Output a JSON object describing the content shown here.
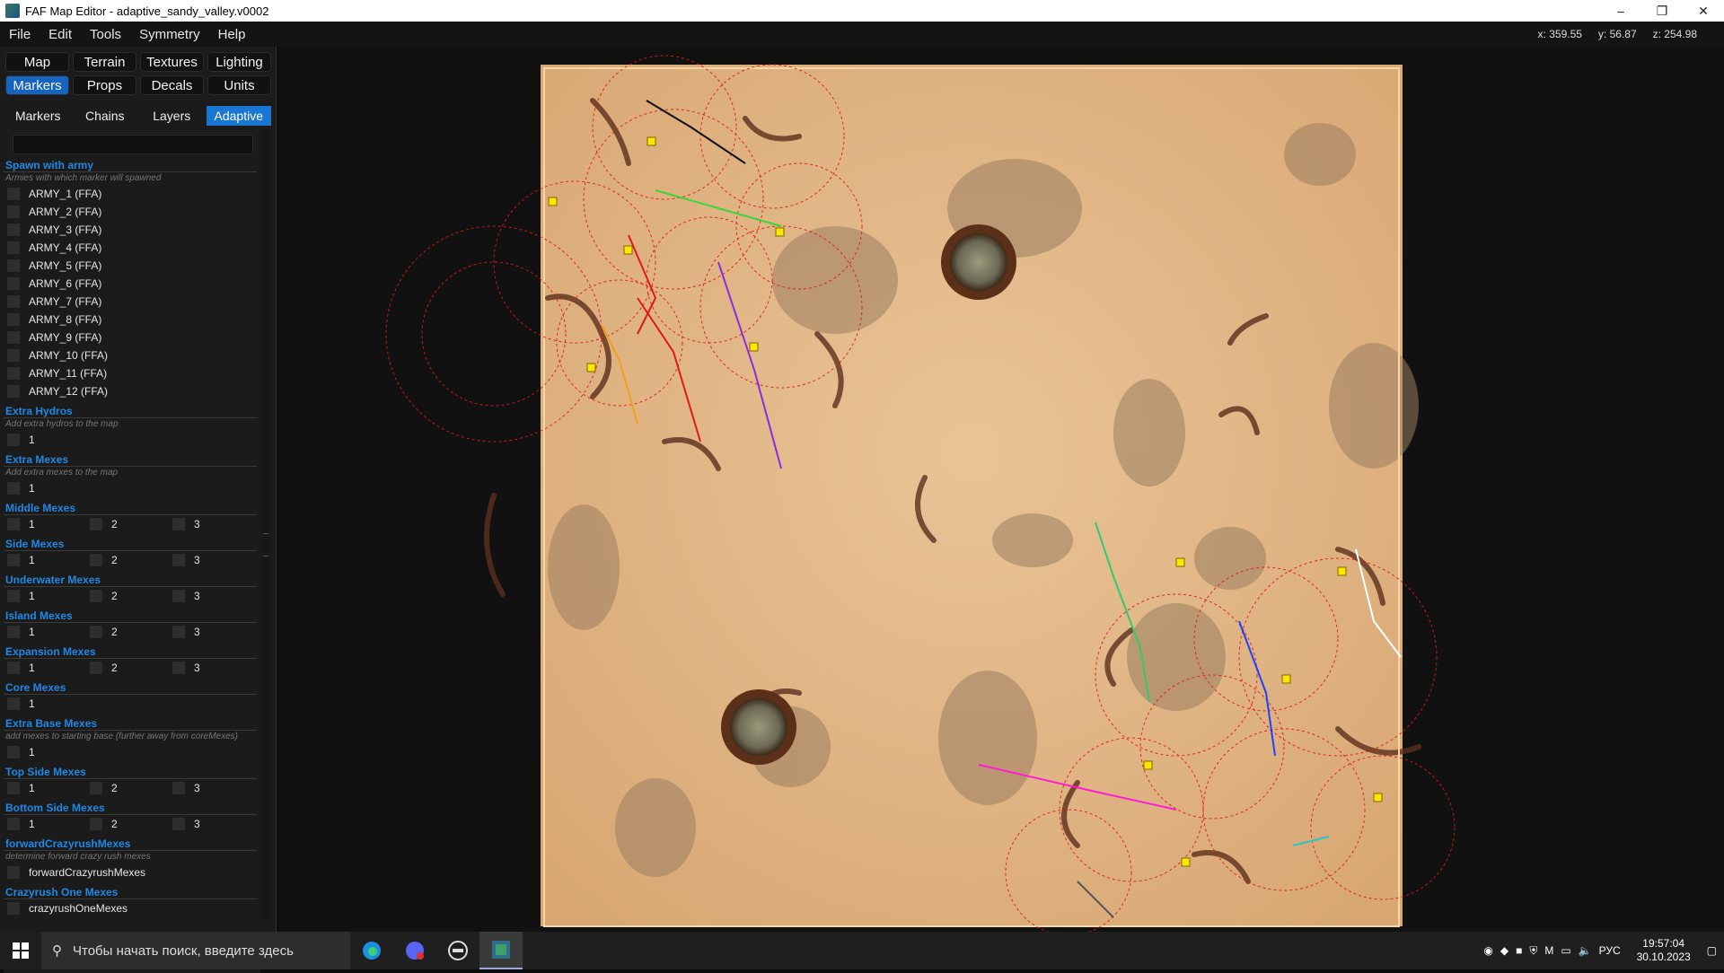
{
  "window": {
    "title": "FAF Map Editor - adaptive_sandy_valley.v0002",
    "minimize": "–",
    "maximize": "❐",
    "close": "✕"
  },
  "menu": [
    "File",
    "Edit",
    "Tools",
    "Symmetry",
    "Help"
  ],
  "coords": {
    "x": "x: 359.55",
    "y": "y: 56.87",
    "z": "z: 254.98"
  },
  "main_tabs": [
    {
      "label": "Map",
      "active": false
    },
    {
      "label": "Terrain",
      "active": false
    },
    {
      "label": "Textures",
      "active": false
    },
    {
      "label": "Lighting",
      "active": false
    },
    {
      "label": "Markers",
      "active": true
    },
    {
      "label": "Props",
      "active": false
    },
    {
      "label": "Decals",
      "active": false
    },
    {
      "label": "Units",
      "active": false
    }
  ],
  "sub_tabs": [
    {
      "label": "Markers",
      "active": false
    },
    {
      "label": "Chains",
      "active": false
    },
    {
      "label": "Layers",
      "active": false
    },
    {
      "label": "Adaptive",
      "active": true
    }
  ],
  "spawn_section": {
    "title": "Spawn with army",
    "desc": "Armies with which marker will spawned",
    "armies": [
      "ARMY_1 (FFA)",
      "ARMY_2 (FFA)",
      "ARMY_3 (FFA)",
      "ARMY_4 (FFA)",
      "ARMY_5 (FFA)",
      "ARMY_6 (FFA)",
      "ARMY_7 (FFA)",
      "ARMY_8 (FFA)",
      "ARMY_9 (FFA)",
      "ARMY_10 (FFA)",
      "ARMY_11 (FFA)",
      "ARMY_12 (FFA)"
    ]
  },
  "sections": [
    {
      "title": "Extra Hydros",
      "desc": "Add extra hydros to the map",
      "options": [
        "1"
      ]
    },
    {
      "title": "Extra Mexes",
      "desc": "Add extra mexes to the map",
      "options": [
        "1"
      ]
    },
    {
      "title": "Middle Mexes",
      "desc": "",
      "options": [
        "1",
        "2",
        "3"
      ]
    },
    {
      "title": "Side Mexes",
      "desc": "",
      "options": [
        "1",
        "2",
        "3"
      ]
    },
    {
      "title": "Underwater Mexes",
      "desc": "",
      "options": [
        "1",
        "2",
        "3"
      ]
    },
    {
      "title": "Island Mexes",
      "desc": "",
      "options": [
        "1",
        "2",
        "3"
      ]
    },
    {
      "title": "Expansion Mexes",
      "desc": "",
      "options": [
        "1",
        "2",
        "3"
      ]
    },
    {
      "title": "Core Mexes",
      "desc": "",
      "options": [
        "1"
      ]
    },
    {
      "title": "Extra Base Mexes",
      "desc": "add mexes to starting base (further away from coreMexes)",
      "options": [
        "1"
      ]
    },
    {
      "title": "Top Side Mexes",
      "desc": "",
      "options": [
        "1",
        "2",
        "3"
      ]
    },
    {
      "title": "Bottom Side Mexes",
      "desc": "",
      "options": [
        "1",
        "2",
        "3"
      ]
    },
    {
      "title": "forwardCrazyrushMexes",
      "desc": "determine forward crazy rush mexes",
      "options": [
        "forwardCrazyrushMexes"
      ]
    },
    {
      "title": "Crazyrush One Mexes",
      "desc": "",
      "options": [
        "crazyrushOneMexes"
      ]
    }
  ],
  "taskbar": {
    "search_placeholder": "Чтобы начать поиск, введите здесь",
    "language": "РУС",
    "time": "19:57:04",
    "date": "30.10.2023"
  }
}
